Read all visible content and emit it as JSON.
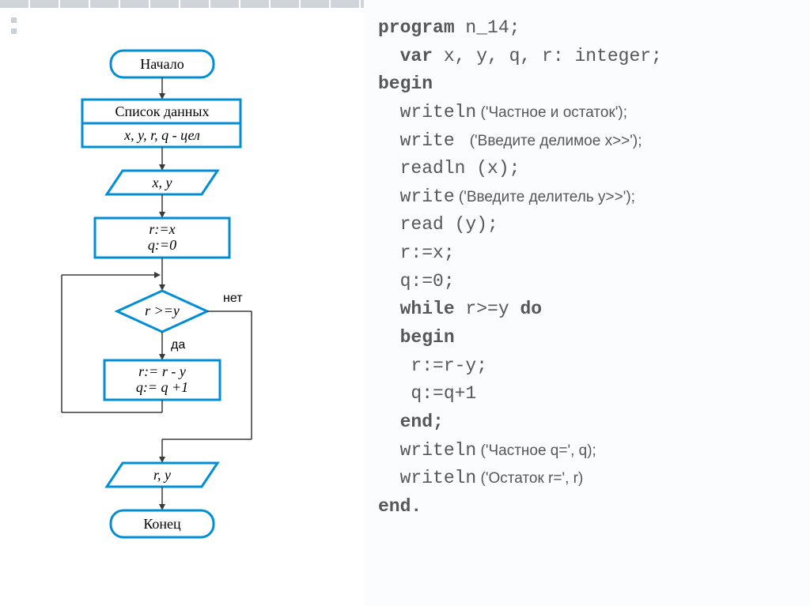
{
  "flowchart": {
    "start": "Начало",
    "data_caption": "Список данных",
    "data_spec": "x, y, r, q - цел",
    "input": "x, y",
    "init1": "r:=x",
    "init2": "q:=0",
    "cond": "r >=y",
    "cond_no": "нет",
    "cond_yes": "да",
    "body1": "r:= r - y",
    "body2": "q:= q +1",
    "output": "r, y",
    "end": "Конец"
  },
  "code": {
    "l1a": "program",
    "l1b": " n_14;",
    "l2a": "  var",
    "l2b": " x, y, q, r: integer;",
    "l3": "begin",
    "l4a": "  writeln",
    "l4b": " ('Частное и остаток');",
    "l5a": "  write ",
    "l5b": " ('Введите делимое x>>');",
    "l6": "  readln (x);",
    "l7a": "  write",
    "l7b": " ('Введите делитель y>>');",
    "l8": "  read (y);",
    "l9": "  r:=x;",
    "l10": "  q:=0;",
    "l11a": "  while",
    "l11b": " r>=y ",
    "l11c": "do",
    "l12": "  begin",
    "l13": "   r:=r-y;",
    "l14": "   q:=q+1",
    "l15": "  end;",
    "l16a": "  writeln",
    "l16b": " ('Частное q=', q);",
    "l17a": "  writeln",
    "l17b": " ('Остаток r=', r)",
    "l18": "end."
  }
}
